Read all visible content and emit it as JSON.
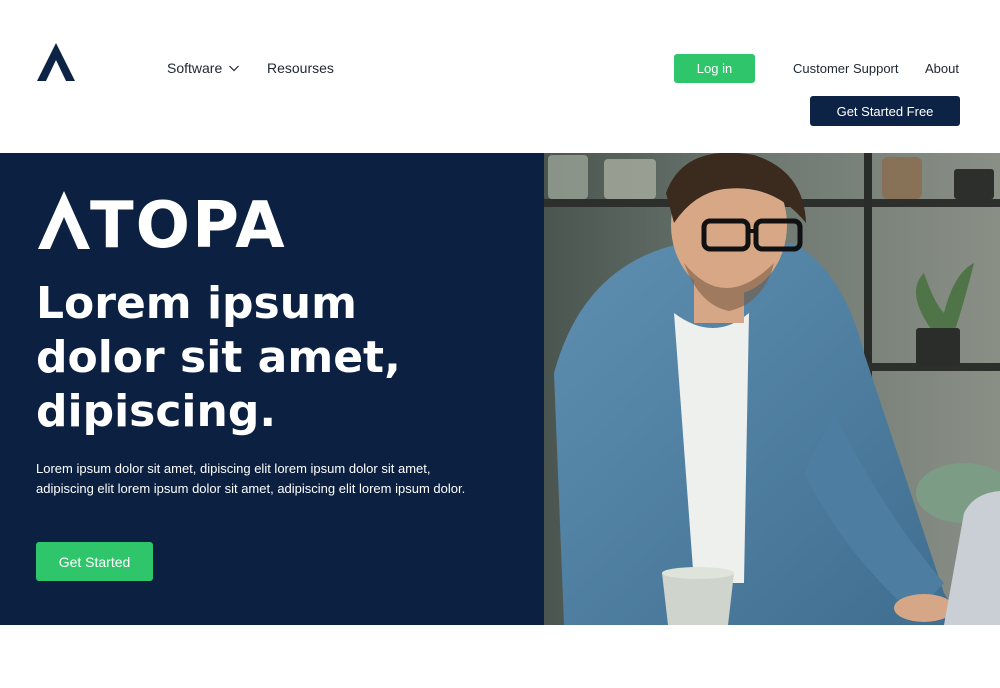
{
  "header": {
    "logo_icon": "atopa-logo-icon",
    "nav": {
      "software_label": "Software",
      "resources_label": "Resourses"
    },
    "login_label": "Log in",
    "support_label": "Customer Support",
    "about_label": "About",
    "get_started_free_label": "Get Started Free"
  },
  "hero": {
    "brand_rest": "TOPA",
    "headline": "Lorem ipsum dolor sit amet, dipiscing.",
    "description": "Lorem ipsum dolor sit amet, dipiscing elit lorem ipsum dolor sit amet, adipiscing elit lorem ipsum dolor sit amet, adipiscing elit lorem ipsum dolor.",
    "cta_label": "Get Started",
    "photo_subject": "man-with-glasses-using-laptop"
  },
  "colors": {
    "accent_green": "#2fc56b",
    "navy": "#0c2041",
    "button_navy": "#0d2346"
  }
}
